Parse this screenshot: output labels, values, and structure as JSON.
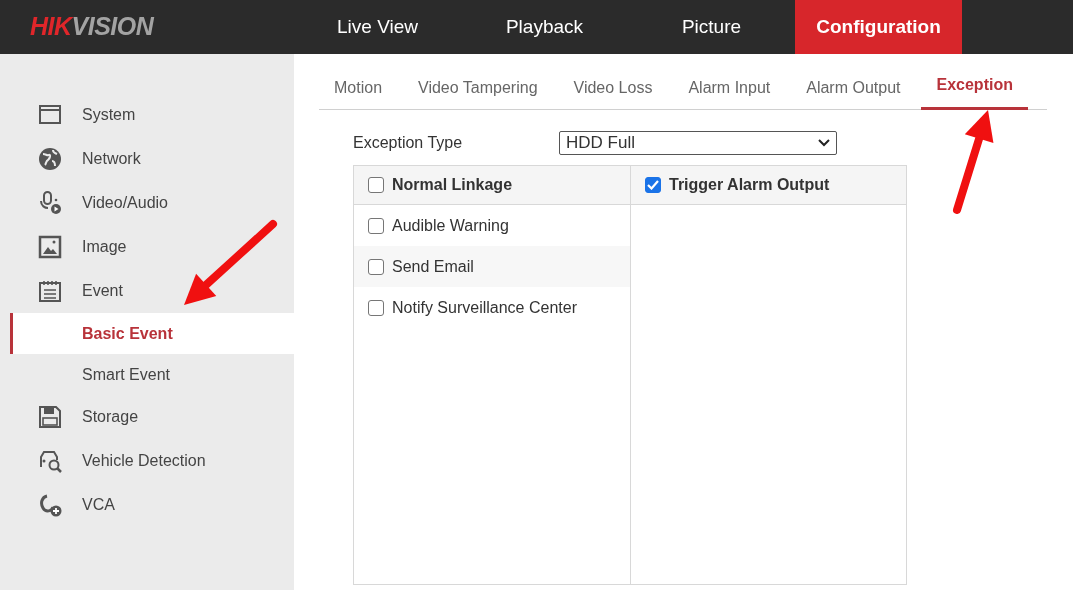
{
  "logo": {
    "parts": [
      {
        "text": "HIK",
        "color": "#e0262a"
      },
      {
        "text": "VISION",
        "color": "#a3a3a3"
      }
    ]
  },
  "top_nav": [
    {
      "label": "Live View",
      "selected": false
    },
    {
      "label": "Playback",
      "selected": false
    },
    {
      "label": "Picture",
      "selected": false
    },
    {
      "label": "Configuration",
      "selected": true
    }
  ],
  "sidebar": {
    "items": [
      {
        "label": "System",
        "selected": false
      },
      {
        "label": "Network",
        "selected": false
      },
      {
        "label": "Video/Audio",
        "selected": false
      },
      {
        "label": "Image",
        "selected": false
      },
      {
        "label": "Event",
        "selected": false,
        "children": [
          {
            "label": "Basic Event",
            "selected": true
          },
          {
            "label": "Smart Event",
            "selected": false
          }
        ]
      },
      {
        "label": "Storage",
        "selected": false
      },
      {
        "label": "Vehicle Detection",
        "selected": false
      },
      {
        "label": "VCA",
        "selected": false
      }
    ]
  },
  "tabs": [
    {
      "label": "Motion",
      "selected": false
    },
    {
      "label": "Video Tampering",
      "selected": false
    },
    {
      "label": "Video Loss",
      "selected": false
    },
    {
      "label": "Alarm Input",
      "selected": false
    },
    {
      "label": "Alarm Output",
      "selected": false
    },
    {
      "label": "Exception",
      "selected": true
    }
  ],
  "exception_type": {
    "label": "Exception Type",
    "value": "HDD Full"
  },
  "linkage": {
    "columns": [
      {
        "label": "Normal Linkage",
        "checked": false,
        "items": [
          {
            "label": "Audible Warning",
            "checked": false
          },
          {
            "label": "Send Email",
            "checked": false
          },
          {
            "label": "Notify Surveillance Center",
            "checked": false
          }
        ]
      },
      {
        "label": "Trigger Alarm Output",
        "checked": true
      }
    ]
  },
  "annotations": [
    {
      "kind": "arrow"
    },
    {
      "kind": "arrow"
    }
  ]
}
